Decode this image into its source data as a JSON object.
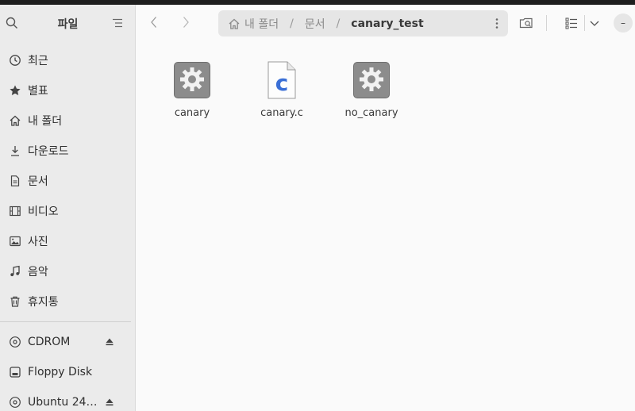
{
  "sidebar": {
    "title": "파일",
    "places": [
      {
        "label": "최근",
        "icon": "clock-icon"
      },
      {
        "label": "별표",
        "icon": "star-icon"
      },
      {
        "label": "내 폴더",
        "icon": "home-icon"
      },
      {
        "label": "다운로드",
        "icon": "download-icon"
      },
      {
        "label": "문서",
        "icon": "document-icon"
      },
      {
        "label": "비디오",
        "icon": "film-icon"
      },
      {
        "label": "사진",
        "icon": "image-icon"
      },
      {
        "label": "음악",
        "icon": "music-icon"
      },
      {
        "label": "휴지통",
        "icon": "trash-icon"
      }
    ],
    "devices": [
      {
        "label": "CDROM",
        "icon": "disc-icon",
        "ejectable": true
      },
      {
        "label": "Floppy Disk",
        "icon": "drive-icon",
        "ejectable": false
      },
      {
        "label": "Ubuntu 24…",
        "icon": "disc-icon",
        "ejectable": true
      }
    ]
  },
  "header": {
    "breadcrumb": [
      "내 폴더",
      "문서",
      "canary_test"
    ],
    "separator": "/",
    "win_label": "–"
  },
  "files": [
    {
      "name": "canary",
      "type": "executable"
    },
    {
      "name": "canary.c",
      "type": "c-source",
      "glyph": "c"
    },
    {
      "name": "no_canary",
      "type": "executable"
    }
  ],
  "colors": {
    "c_glyph": "#3a6fd6",
    "exec_bg": "#8c8c8c"
  }
}
